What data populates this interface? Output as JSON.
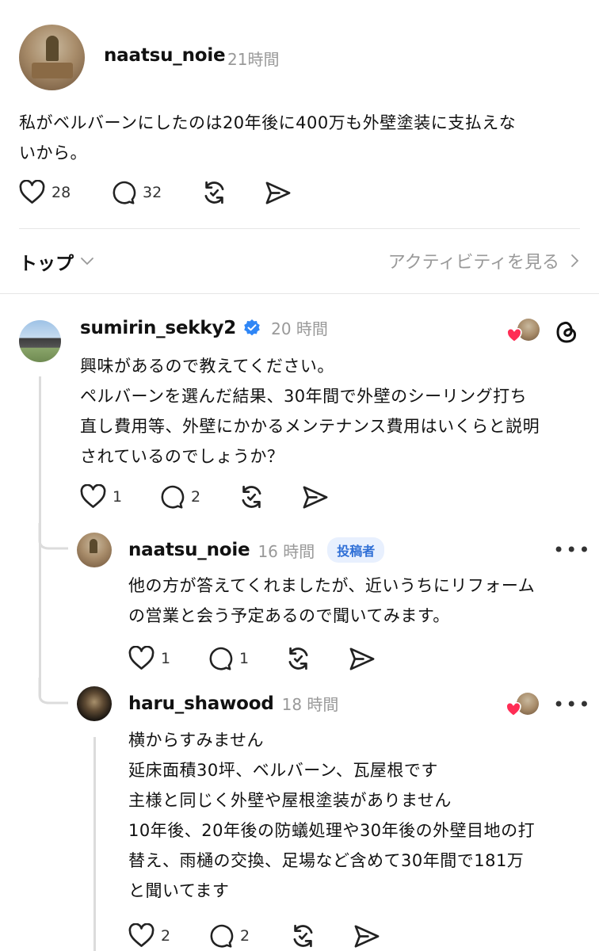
{
  "main_post": {
    "username": "naatsu_noie",
    "time": "21時間",
    "text_lines": [
      "私がベルバーンにしたのは20年後に400万も外壁塗装に支払えな",
      "いから。"
    ],
    "likes": "28",
    "comments": "32"
  },
  "tabs": {
    "sort_label": "トップ",
    "activity_label": "アクティビティを見る"
  },
  "reply1": {
    "username": "sumirin_sekky2",
    "time": "20 時間",
    "text_lines": [
      "興味があるので教えてください。",
      "ペルバーンを選んだ結果、30年間で外壁のシーリング打ち",
      "直し費用等、外壁にかかるメンテナンス費用はいくらと説明",
      "されているのでしょうか？"
    ],
    "likes": "1",
    "comments": "2"
  },
  "reply2": {
    "username": "naatsu_noie",
    "time": "16 時間",
    "badge": "投稿者",
    "text_lines": [
      "他の方が答えてくれましたが、近いうちにリフォーム",
      "の営業と会う予定あるので聞いてみます。"
    ],
    "likes": "1",
    "comments": "1"
  },
  "reply3": {
    "username": "haru_shawood",
    "time": "18 時間",
    "text_lines": [
      "横からすみません",
      "延床面積30坪、ベルバーン、瓦屋根です",
      "主様と同じく外壁や屋根塗装がありません",
      "10年後、20年後の防蟻処理や30年後の外壁目地の打",
      "替え、雨樋の交換、足場など含めて30年間で181万",
      "と聞いてます"
    ],
    "likes": "2",
    "comments": "2"
  },
  "icons": {
    "like": "heart-icon",
    "comment": "comment-bubble-icon",
    "repost": "repost-icon",
    "share": "send-icon",
    "threads": "threads-logo-icon",
    "more": "more-dots-icon",
    "verified": "verified-badge-icon",
    "liked_by_author": "heart-with-avatar-icon"
  },
  "colors": {
    "verified": "#2f86f6",
    "author_badge_bg": "#e8f0fe",
    "author_badge_text": "#2f6fd6",
    "heart_red": "#ff2d55",
    "muted": "#999999"
  }
}
